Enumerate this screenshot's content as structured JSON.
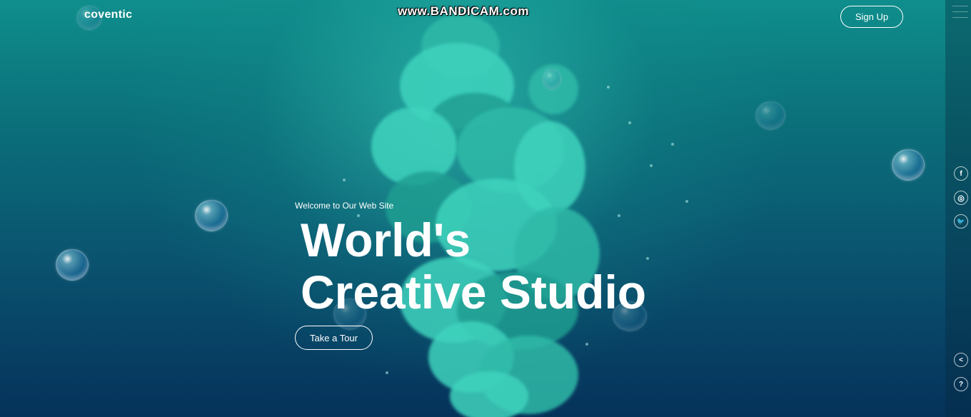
{
  "brand": {
    "logo_text": "coventic"
  },
  "watermark": {
    "text": "www.BANDICAM.com"
  },
  "header": {
    "signup_label": "Sign Up"
  },
  "hero": {
    "kicker": "Welcome to Our Web Site",
    "title_line1": "World's",
    "title_line2": "Creative Studio",
    "cta_label": "Take a Tour"
  },
  "social": [
    {
      "icon": "facebook-icon",
      "glyph": "f"
    },
    {
      "icon": "instagram-icon",
      "glyph": "◎"
    },
    {
      "icon": "twitter-icon",
      "glyph": "🐦"
    }
  ],
  "utility": {
    "share_glyph": "<",
    "help_glyph": "?"
  },
  "colors": {
    "background_top": "#0f8e8c",
    "background_bottom": "#06325a",
    "ink": "#3fd3bd",
    "text": "#ffffff"
  }
}
